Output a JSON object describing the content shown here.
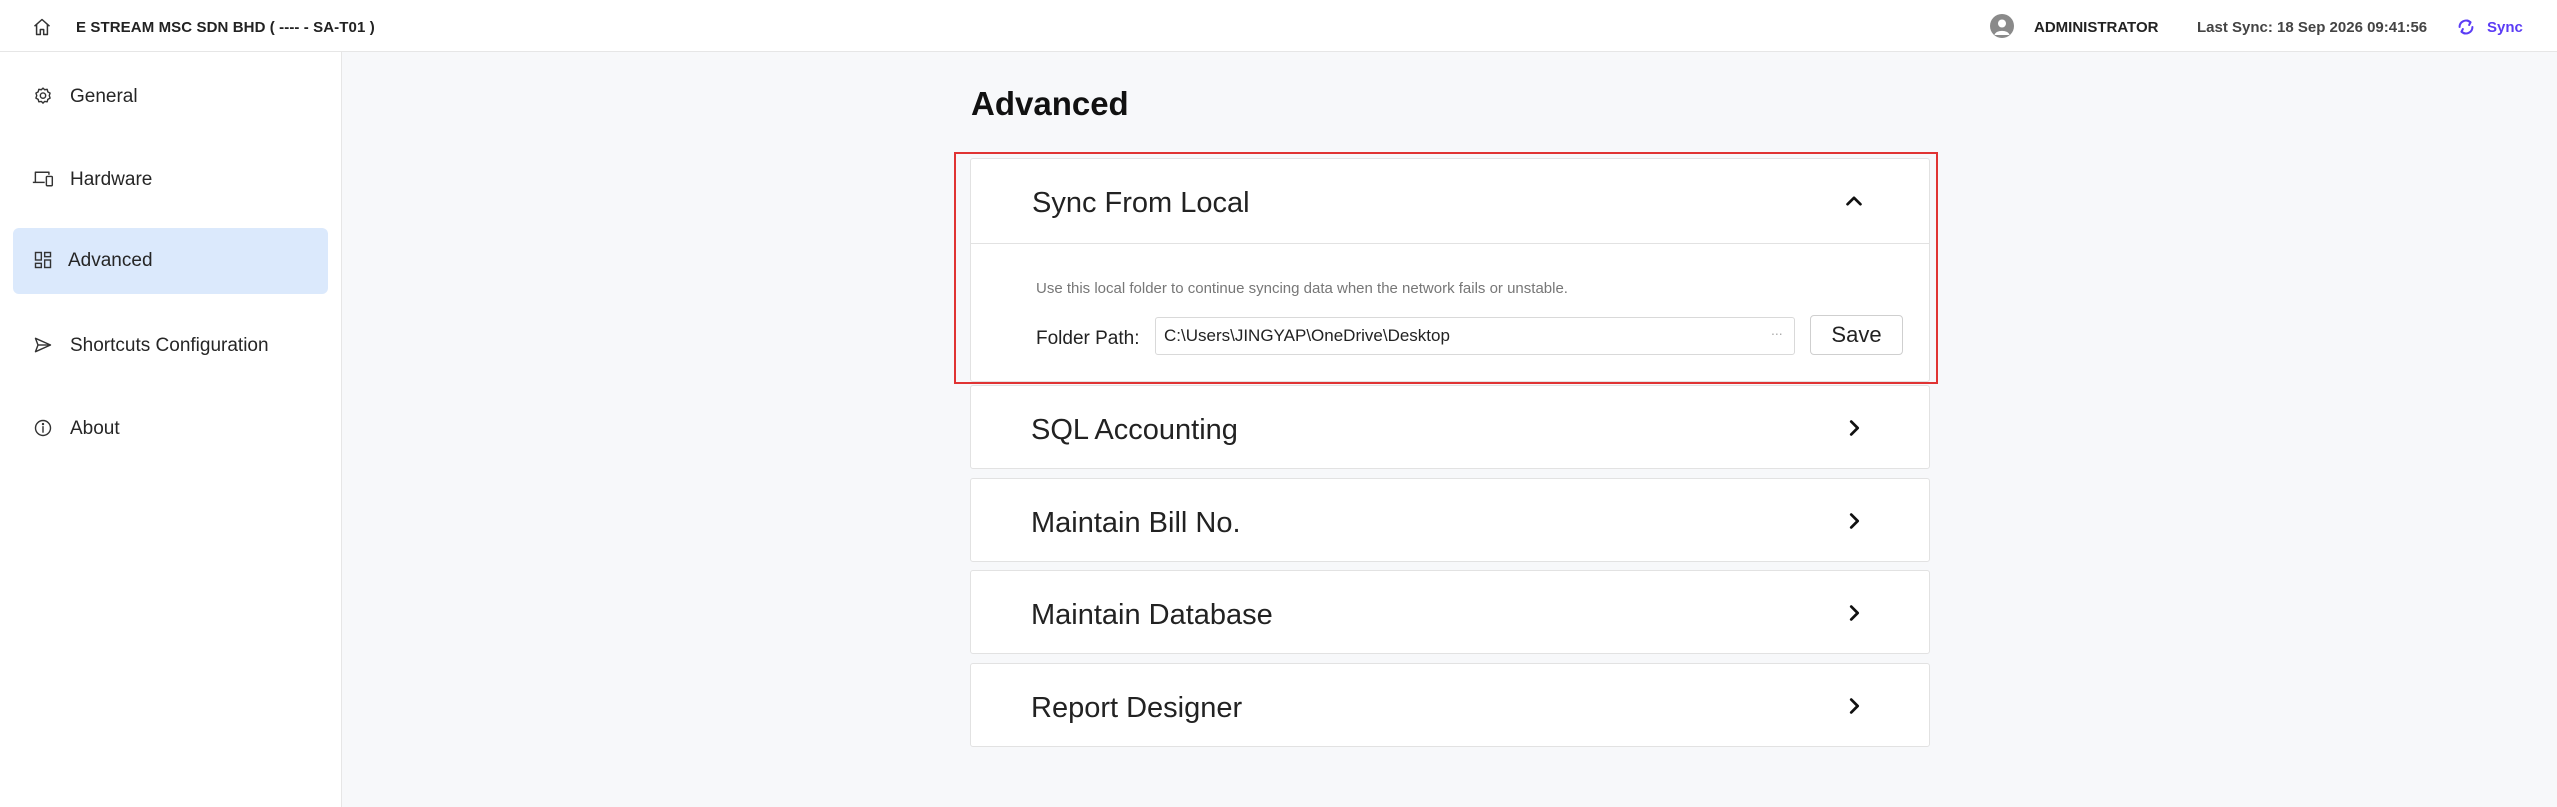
{
  "topbar": {
    "company": "E STREAM MSC SDN BHD ( ---- - SA-T01 )",
    "user": "ADMINISTRATOR",
    "last_sync": "Last Sync: 18 Sep 2026 09:41:56",
    "sync_label": "Sync",
    "accent_color": "#5b3cf5"
  },
  "sidebar": {
    "items": [
      {
        "label": "General",
        "icon": "gear-icon"
      },
      {
        "label": "Hardware",
        "icon": "devices-icon"
      },
      {
        "label": "Advanced",
        "icon": "grid-icon",
        "active": true
      },
      {
        "label": "Shortcuts Configuration",
        "icon": "send-icon"
      },
      {
        "label": "About",
        "icon": "info-icon"
      }
    ]
  },
  "main": {
    "title": "Advanced",
    "sections": [
      {
        "title": "Sync From Local",
        "expanded": true,
        "description": "Use this local folder to continue syncing data when the network fails or unstable.",
        "folder_label": "Folder Path:",
        "folder_value": "C:\\Users\\JINGYAP\\OneDrive\\Desktop",
        "browse_label": "...",
        "save_label": "Save"
      },
      {
        "title": "SQL Accounting",
        "expanded": false
      },
      {
        "title": "Maintain Bill No.",
        "expanded": false
      },
      {
        "title": "Maintain Database",
        "expanded": false
      },
      {
        "title": "Report Designer",
        "expanded": false
      }
    ]
  }
}
